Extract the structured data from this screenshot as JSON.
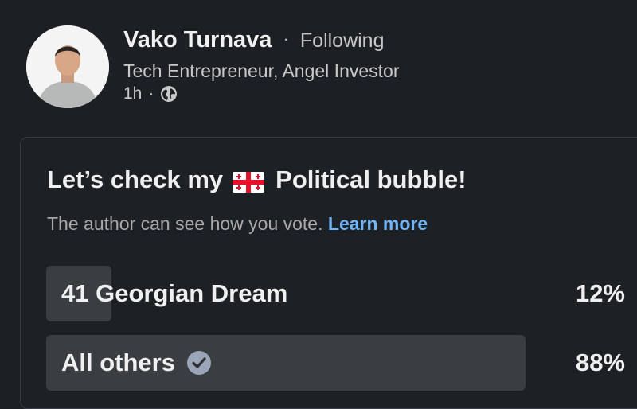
{
  "author": {
    "name": "Vako Turnava",
    "separator": "·",
    "follow_status": "Following",
    "headline": "Tech Entrepreneur, Angel Investor",
    "time": "1h",
    "meta_separator": "·",
    "visibility_icon": "globe-icon"
  },
  "poll": {
    "title_before_flag": "Let’s check my",
    "flag_icon": "georgia-flag-icon",
    "title_after_flag": "Political bubble!",
    "disclaimer": "The author can see how you vote.",
    "learn_more": "Learn more",
    "options": [
      {
        "label": "41 Georgian Dream",
        "percent": "12%",
        "fill": 0.12,
        "selected": false
      },
      {
        "label": "All others",
        "percent": "88%",
        "fill": 0.88,
        "selected": true
      }
    ]
  },
  "colors": {
    "background": "#1c1f23",
    "link": "#70b5f9",
    "option_fill": "#3a3d41",
    "flag_red": "#e8112d"
  }
}
